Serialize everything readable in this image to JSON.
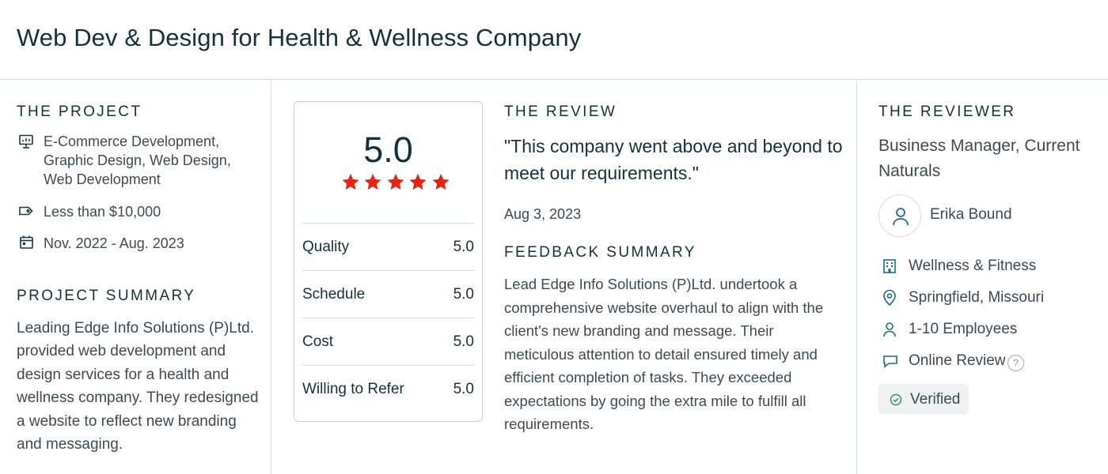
{
  "header": {
    "title": "Web Dev & Design for Health & Wellness Company"
  },
  "project": {
    "section_title": "THE PROJECT",
    "services": [
      "E-Commerce Development,",
      "Graphic Design, Web Design,",
      "Web Development"
    ],
    "budget": "Less than $10,000",
    "dates": "Nov. 2022 - Aug. 2023",
    "icons": [
      "presentation-icon",
      "tag-icon",
      "calendar-icon"
    ]
  },
  "project_summary": {
    "section_title": "PROJECT SUMMARY",
    "text": "Leading Edge Info Solutions (P)Ltd. provided web development and design services for a health and wellness company. They redesigned a website to reflect new branding and messaging."
  },
  "rating": {
    "overall": "5.0",
    "stars": 5,
    "star_color": "#e62415",
    "rows": [
      {
        "label": "Quality",
        "value": "5.0"
      },
      {
        "label": "Schedule",
        "value": "5.0"
      },
      {
        "label": "Cost",
        "value": "5.0"
      },
      {
        "label": "Willing to Refer",
        "value": "5.0"
      }
    ]
  },
  "review": {
    "section_title": "THE REVIEW",
    "quote": "\"This company went above and beyond to meet our requirements.\"",
    "date": "Aug 3, 2023",
    "feedback_title": "FEEDBACK SUMMARY",
    "feedback": "Lead Edge Info Solutions (P)Ltd. undertook a comprehensive website overhaul to align with the client's new branding and message. Their meticulous attention to detail ensured timely and efficient completion of tasks. They exceeded expectations by going the extra mile to fulfill all requirements."
  },
  "reviewer": {
    "section_title": "THE REVIEWER",
    "role": "Business Manager, Current Naturals",
    "name": "Erika Bound",
    "industry": "Wellness & Fitness",
    "location": "Springfield, Missouri",
    "size": "1-10 Employees",
    "review_type": "Online Review",
    "help": "?",
    "verified": "Verified",
    "icons": [
      "user-icon",
      "building-icon",
      "location-pin-icon",
      "people-icon",
      "chat-bubble-icon",
      "check-circle-icon"
    ]
  },
  "colors": {
    "text": "#17313b",
    "body_text": "#3e4a52",
    "divider": "#d3dbe0"
  }
}
